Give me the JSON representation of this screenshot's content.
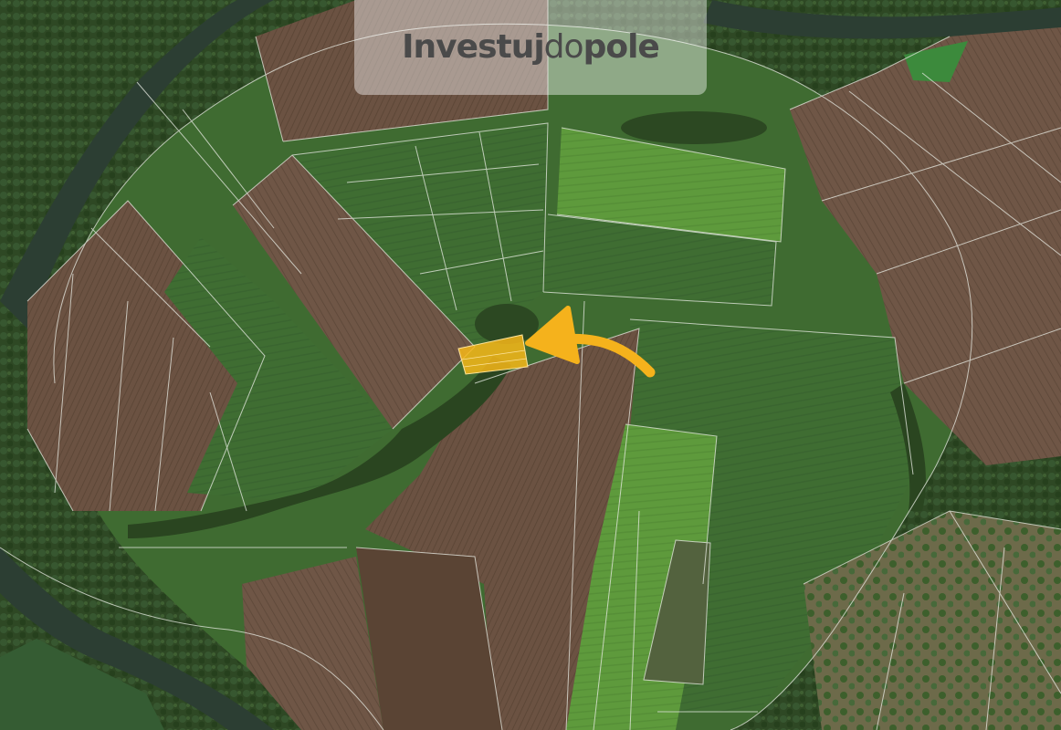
{
  "logo": {
    "part1": "Investuj",
    "part2": "do",
    "part3": "pole"
  },
  "colors": {
    "highlight_parcel": "#f7b719",
    "arrow": "#f5b21c",
    "field_green": "#3e6b2f",
    "field_bright_green": "#5d9a3c",
    "field_brown": "#6a5240",
    "river": "#2d4034",
    "forest": "#2f4a25",
    "parcel_lines": "#e8e8e8"
  },
  "icons": {
    "pointer_arrow": "curved-arrow-icon"
  }
}
